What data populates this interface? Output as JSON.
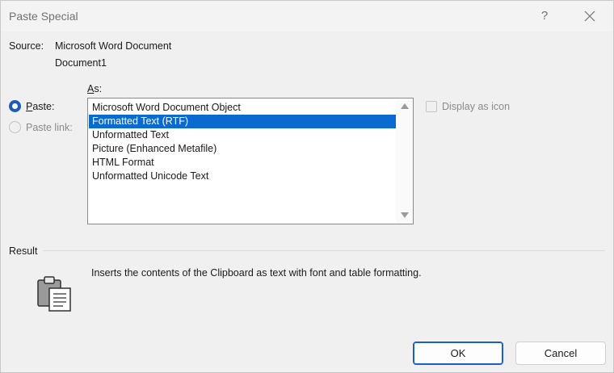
{
  "window": {
    "title": "Paste Special",
    "help_label": "?"
  },
  "source": {
    "label": "Source:",
    "line1": "Microsoft Word Document",
    "line2": "Document1"
  },
  "as": {
    "label_prefix": "A",
    "label_rest": "s:"
  },
  "paste_options": {
    "paste_prefix": "P",
    "paste_rest": "aste:",
    "paste_selected": true,
    "paste_link_label": "Paste link:",
    "paste_link_enabled": false
  },
  "formats": {
    "items": [
      "Microsoft Word Document Object",
      "Formatted Text (RTF)",
      "Unformatted Text",
      "Picture (Enhanced Metafile)",
      "HTML Format",
      "Unformatted Unicode Text"
    ],
    "selected_index": 1
  },
  "display_as_icon": {
    "label": "Display as icon",
    "checked": false,
    "enabled": false
  },
  "result": {
    "label": "Result",
    "description": "Inserts the contents of the Clipboard as text with font and table formatting."
  },
  "buttons": {
    "ok": "OK",
    "cancel": "Cancel"
  },
  "colors": {
    "accent": "#0a6ad0",
    "radio_accent": "#1d5bb9",
    "background": "#f0f0f0"
  },
  "icons": {
    "close": "close-icon",
    "clipboard": "clipboard-icon"
  }
}
